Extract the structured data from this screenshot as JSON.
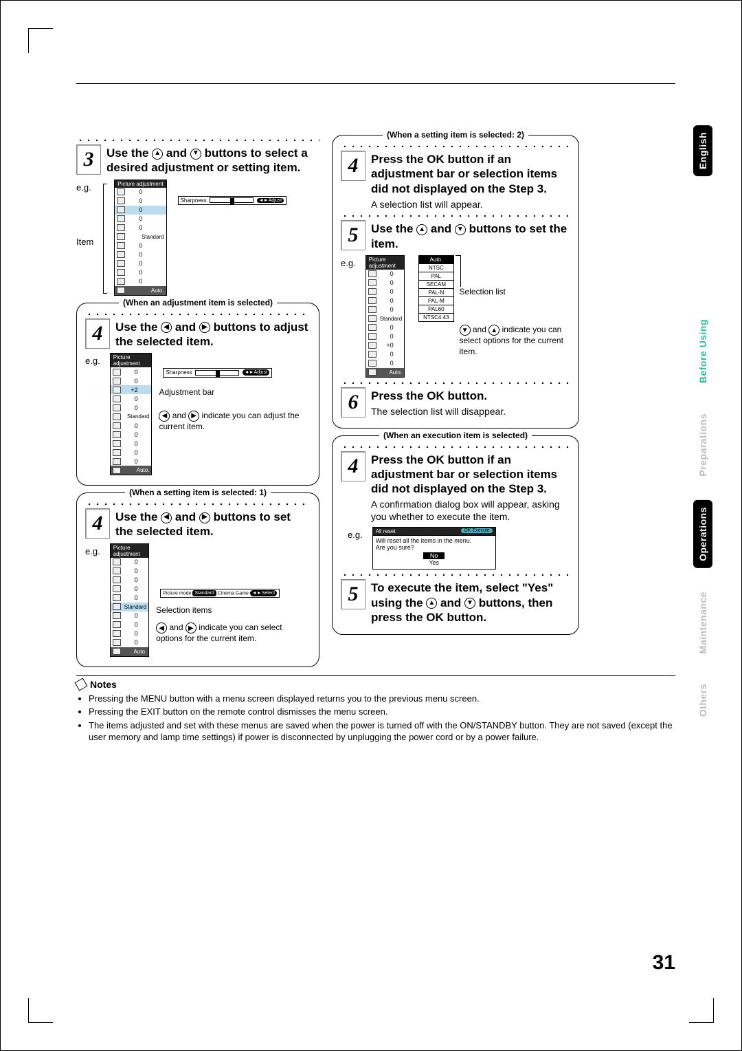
{
  "language_tab": "English",
  "tabs": {
    "before_using": "Before Using",
    "preparations": "Preparations",
    "operations": "Operations",
    "maintenance": "Maintenance",
    "others": "Others"
  },
  "page_number": "31",
  "left": {
    "step3": {
      "num": "3",
      "text_parts": [
        "Use the ",
        " and ",
        " buttons to select a desired adjustment or setting item."
      ]
    },
    "eg_label": "e.g.",
    "item_label": "Item",
    "osd_title": "Picture adjustment",
    "osd_rows": [
      {
        "val": "0"
      },
      {
        "val": "0"
      },
      {
        "val": "0",
        "sel": true
      },
      {
        "val": "0"
      },
      {
        "val": "0"
      },
      {
        "text": "Standard"
      },
      {
        "val": "0"
      },
      {
        "val": "0"
      },
      {
        "val": "0"
      },
      {
        "val": "0"
      },
      {
        "val": "0"
      },
      {
        "text": "Auto.",
        "auto": true
      }
    ],
    "adj_label": "Sharpness",
    "adj_tag": "Adjust",
    "box1": {
      "title": "(When an adjustment item is selected)",
      "step_num": "4",
      "step_text_parts": [
        "Use the ",
        " and ",
        " buttons to adjust the selected item."
      ],
      "eg": "e.g.",
      "osd_title": "Picture adjustment",
      "rows": [
        {
          "val": "0"
        },
        {
          "val": "0"
        },
        {
          "val": "+2",
          "sel": true
        },
        {
          "val": "0"
        },
        {
          "val": "0"
        },
        {
          "text": "Standard"
        },
        {
          "val": "0"
        },
        {
          "val": "0"
        },
        {
          "val": "0"
        },
        {
          "val": "0"
        },
        {
          "val": "0"
        },
        {
          "text": "Auto.",
          "auto": true
        }
      ],
      "adj_label": "Sharpness",
      "adj_tag": "Adjust",
      "callout1": "Adjustment bar",
      "callout2_parts": [
        " and ",
        " indicate you can adjust the current item."
      ]
    },
    "box2": {
      "title": "(When a setting item is selected: 1)",
      "step_num": "4",
      "step_text_parts": [
        "Use the ",
        " and ",
        " buttons to set the selected item."
      ],
      "eg": "e.g.",
      "osd_title": "Picture adjustment",
      "rows": [
        {
          "val": "0"
        },
        {
          "val": "0"
        },
        {
          "val": "0"
        },
        {
          "val": "0"
        },
        {
          "val": "0"
        },
        {
          "text": "Standard",
          "selrow": true
        },
        {
          "val": "0"
        },
        {
          "val": "0"
        },
        {
          "val": "0"
        },
        {
          "val": "0"
        },
        {
          "text": "Auto.",
          "auto": true
        }
      ],
      "mode_label": "Picture mode",
      "mode_opts": [
        "Standard",
        "Cinema",
        "Game"
      ],
      "mode_tag": "Select",
      "callout1": "Selection items",
      "callout2_parts": [
        " and ",
        " indicate you can select options for the current item."
      ]
    }
  },
  "right": {
    "box_setting2": {
      "title": "(When a setting item is selected: 2)",
      "step4_num": "4",
      "step4_text": "Press the OK button if an adjustment bar or selection items did not displayed on the Step 3.",
      "step4_sub": "A selection list will appear.",
      "step5_num": "5",
      "step5_text_parts": [
        "Use the ",
        " and ",
        " buttons to set the item."
      ],
      "eg": "e.g.",
      "osd_title": "Picture adjustment",
      "rows": [
        {
          "val": "0"
        },
        {
          "val": "0"
        },
        {
          "val": "0"
        },
        {
          "val": "0"
        },
        {
          "val": "0"
        },
        {
          "text": "Standard"
        },
        {
          "val": "0"
        },
        {
          "val": "0"
        },
        {
          "val": "+0"
        },
        {
          "val": "0"
        },
        {
          "val": "0"
        },
        {
          "text": "Auto.",
          "auto": true,
          "selrow": true
        }
      ],
      "sel_list": [
        "Auto.",
        "NTSC",
        "PAL",
        "SECAM",
        "PAL-N",
        "PAL-M",
        "PAL60",
        "NTSC4.43"
      ],
      "sel_list_label": "Selection list",
      "callout_parts": [
        " and ",
        " indicate you can select options for the current item."
      ],
      "step6_num": "6",
      "step6_text": "Press the OK button.",
      "step6_sub": "The selection list will disappear."
    },
    "box_exec": {
      "title": "(When an execution item is selected)",
      "step4_num": "4",
      "step4_text": "Press the OK button if an adjustment bar or selection items did not displayed on the Step 3.",
      "step4_sub": "A confirmation dialog box will appear, asking you whether to execute the item.",
      "eg": "e.g.",
      "dlg_title": "All reset",
      "dlg_pill": "Execute",
      "dlg_line1": "Will reset all the items in the menu.",
      "dlg_line2": "Are you sure?",
      "dlg_no": "No",
      "dlg_yes": "Yes",
      "step5_num": "5",
      "step5_text_parts": [
        "To execute the item, select \"Yes\" using the ",
        " and ",
        " buttons, then press the OK button."
      ]
    }
  },
  "notes": {
    "title": "Notes",
    "items": [
      "Pressing the MENU button with a menu screen displayed returns you to the previous menu screen.",
      "Pressing the EXIT button on the remote control dismisses the menu screen.",
      "The items adjusted and set with these menus are saved when the power is turned off with the ON/STANDBY button. They are not saved (except the user memory and lamp time settings) if power is disconnected by unplugging the power cord or by a power failure."
    ]
  }
}
